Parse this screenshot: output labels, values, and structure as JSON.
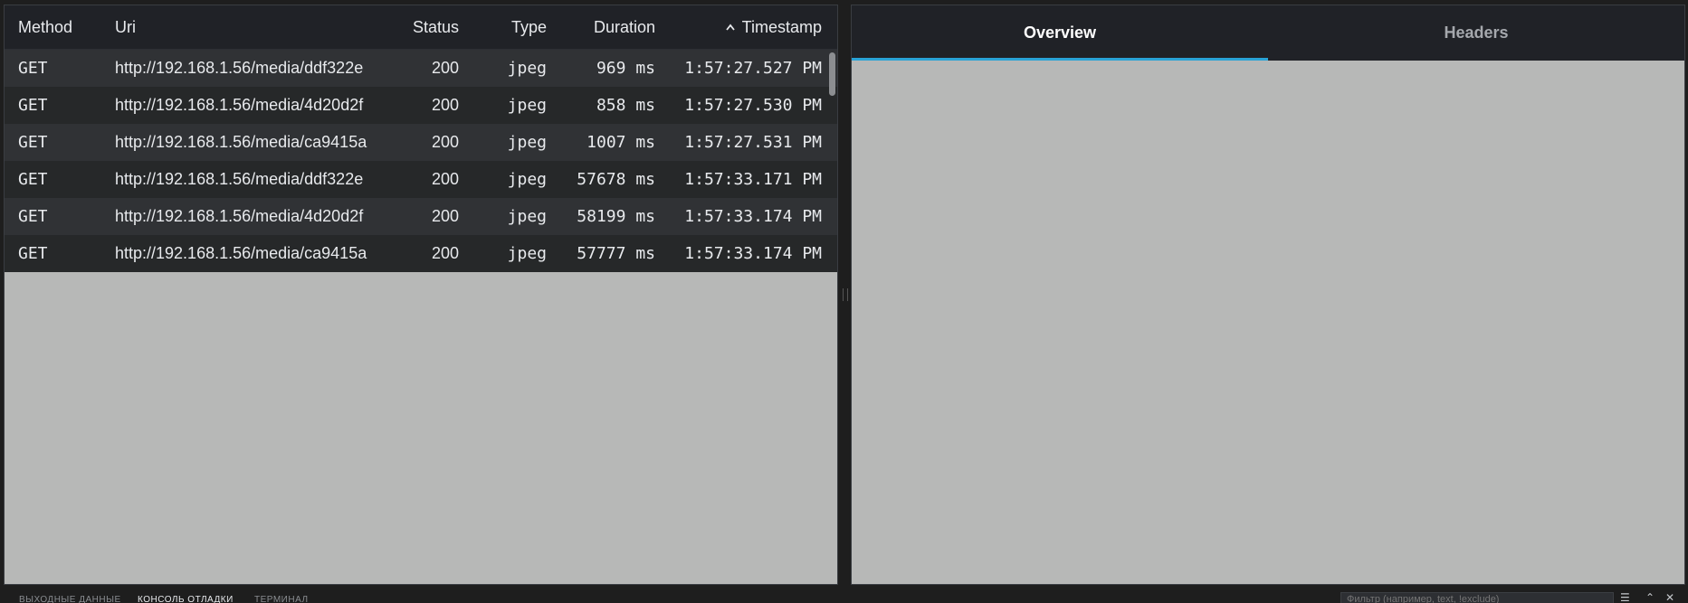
{
  "table": {
    "headers": {
      "method": "Method",
      "uri": "Uri",
      "status": "Status",
      "type": "Type",
      "duration": "Duration",
      "timestamp": "Timestamp"
    },
    "sort_icon": "chevron-up-icon",
    "rows": [
      {
        "method": "GET",
        "uri": "http://192.168.1.56/media/ddf322e",
        "status": "200",
        "type": "jpeg",
        "duration": "969 ms",
        "timestamp": "1:57:27.527 PM"
      },
      {
        "method": "GET",
        "uri": "http://192.168.1.56/media/4d20d2f",
        "status": "200",
        "type": "jpeg",
        "duration": "858 ms",
        "timestamp": "1:57:27.530 PM"
      },
      {
        "method": "GET",
        "uri": "http://192.168.1.56/media/ca9415a",
        "status": "200",
        "type": "jpeg",
        "duration": "1007 ms",
        "timestamp": "1:57:27.531 PM"
      },
      {
        "method": "GET",
        "uri": "http://192.168.1.56/media/ddf322e",
        "status": "200",
        "type": "jpeg",
        "duration": "57678 ms",
        "timestamp": "1:57:33.171 PM"
      },
      {
        "method": "GET",
        "uri": "http://192.168.1.56/media/4d20d2f",
        "status": "200",
        "type": "jpeg",
        "duration": "58199 ms",
        "timestamp": "1:57:33.174 PM"
      },
      {
        "method": "GET",
        "uri": "http://192.168.1.56/media/ca9415a",
        "status": "200",
        "type": "jpeg",
        "duration": "57777 ms",
        "timestamp": "1:57:33.174 PM"
      }
    ]
  },
  "detail": {
    "tabs": [
      {
        "label": "Overview",
        "active": true
      },
      {
        "label": "Headers",
        "active": false
      }
    ]
  },
  "statusbar": {
    "tabs": [
      "ВЫХОДНЫЕ ДАННЫЕ",
      "КОНСОЛЬ ОТЛАДКИ",
      "ТЕРМИНАЛ"
    ],
    "active_tab": "КОНСОЛЬ ОТЛАДКИ",
    "filter_placeholder": "Фильтр (например, text, !exclude)"
  },
  "colors": {
    "accent": "#2aa3d6",
    "panel_bg": "#b7b8b7",
    "header_bg": "#202227"
  }
}
